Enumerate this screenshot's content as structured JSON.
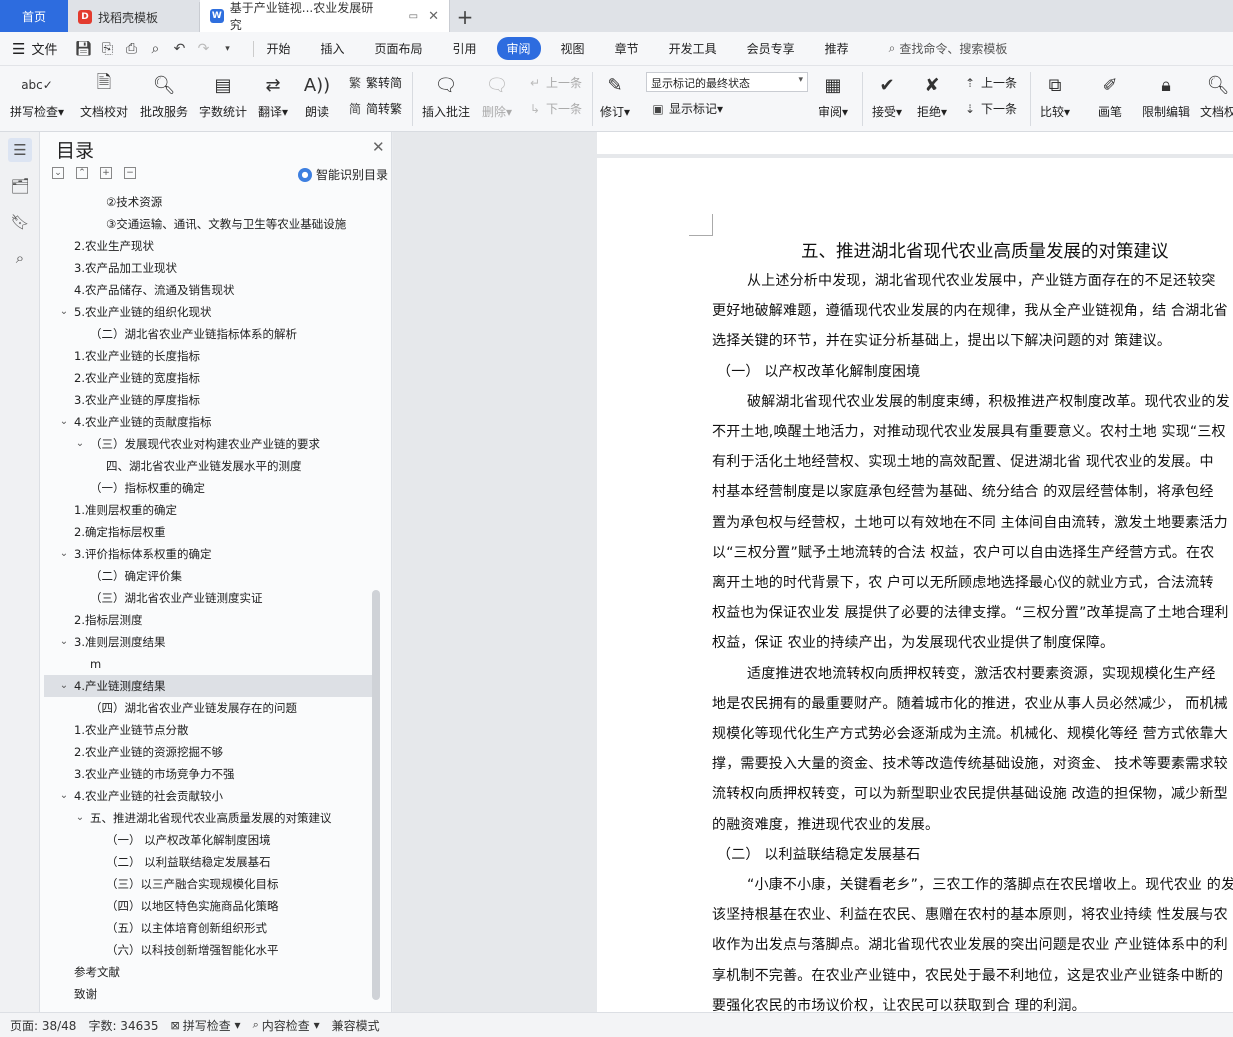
{
  "tabs": {
    "home": "首页",
    "template": "找稻壳模板",
    "doc": "基于产业链视...农业发展研究"
  },
  "menu": {
    "file": "文件",
    "items": [
      "开始",
      "插入",
      "页面布局",
      "引用",
      "审阅",
      "视图",
      "章节",
      "开发工具",
      "会员专享",
      "推荐"
    ],
    "active": "审阅",
    "search": "查找命令、搜索模板"
  },
  "ribbon": {
    "spell": "拼写检查",
    "proof": "文档校对",
    "batch": "批改服务",
    "count": "字数统计",
    "translate": "翻译",
    "read": "朗读",
    "trad": "繁转简",
    "simp": "简转繁",
    "insert_comment": "插入批注",
    "delete": "删除",
    "prev": "上一条",
    "next": "下一条",
    "track": "修订",
    "markup_select": "显示标记的最终状态",
    "show_markup": "显示标记",
    "review": "审阅",
    "accept": "接受",
    "reject": "拒绝",
    "prev2": "上一条",
    "next2": "下一条",
    "compare": "比较",
    "pen": "画笔",
    "restrict": "限制编辑",
    "doc_perm": "文档权"
  },
  "toc": {
    "title": "目录",
    "smart": "智能识别目录",
    "items": [
      {
        "text": "②技术资源",
        "level": 4,
        "chev": ""
      },
      {
        "text": "③交通运输、通讯、文教与卫生等农业基础设施",
        "level": 4,
        "chev": ""
      },
      {
        "text": "2.农业生产现状",
        "level": 2,
        "chev": ""
      },
      {
        "text": "3.农产品加工业现状",
        "level": 2,
        "chev": ""
      },
      {
        "text": "4.农产品储存、流通及销售现状",
        "level": 2,
        "chev": ""
      },
      {
        "text": "5.农业产业链的组织化现状",
        "level": 2,
        "chev": "v"
      },
      {
        "text": "（二）湖北省农业产业链指标体系的解析",
        "level": 3,
        "chev": ""
      },
      {
        "text": "1.农业产业链的长度指标",
        "level": 2,
        "chev": ""
      },
      {
        "text": "2.农业产业链的宽度指标",
        "level": 2,
        "chev": ""
      },
      {
        "text": "3.农业产业链的厚度指标",
        "level": 2,
        "chev": ""
      },
      {
        "text": "4.农业产业链的贡献度指标",
        "level": 2,
        "chev": "v"
      },
      {
        "text": "（三）发展现代农业对构建农业产业链的要求",
        "level": 3,
        "chev": "v"
      },
      {
        "text": "四、湖北省农业产业链发展水平的测度",
        "level": 4,
        "chev": ""
      },
      {
        "text": "（一）指标权重的确定",
        "level": 3,
        "chev": ""
      },
      {
        "text": "1.准则层权重的确定",
        "level": 2,
        "chev": ""
      },
      {
        "text": "2.确定指标层权重",
        "level": 2,
        "chev": ""
      },
      {
        "text": "3.评价指标体系权重的确定",
        "level": 2,
        "chev": "v"
      },
      {
        "text": "（二）确定评价集",
        "level": 3,
        "chev": ""
      },
      {
        "text": "（三）湖北省农业产业链测度实证",
        "level": 3,
        "chev": ""
      },
      {
        "text": "2.指标层测度",
        "level": 2,
        "chev": ""
      },
      {
        "text": "3.准则层测度结果",
        "level": 2,
        "chev": "v"
      },
      {
        "text": "m",
        "level": 3,
        "chev": ""
      },
      {
        "text": "4.产业链测度结果",
        "level": 2,
        "chev": "v"
      },
      {
        "text": "（四）湖北省农业产业链发展存在的问题",
        "level": 3,
        "chev": ""
      },
      {
        "text": "1.农业产业链节点分散",
        "level": 2,
        "chev": ""
      },
      {
        "text": "2.农业产业链的资源挖掘不够",
        "level": 2,
        "chev": ""
      },
      {
        "text": "3.农业产业链的市场竞争力不强",
        "level": 2,
        "chev": ""
      },
      {
        "text": "4.农业产业链的社会贡献较小",
        "level": 2,
        "chev": "v"
      },
      {
        "text": "五、推进湖北省现代农业高质量发展的对策建议",
        "level": 3,
        "chev": "v"
      },
      {
        "text": "（一） 以产权改革化解制度困境",
        "level": 4,
        "chev": ""
      },
      {
        "text": "（二） 以利益联结稳定发展基石",
        "level": 4,
        "chev": ""
      },
      {
        "text": "（三）以三产融合实现规模化目标",
        "level": 4,
        "chev": ""
      },
      {
        "text": "（四）以地区特色实施商品化策略",
        "level": 4,
        "chev": ""
      },
      {
        "text": "（五）以主体培育创新组织形式",
        "level": 4,
        "chev": ""
      },
      {
        "text": "（六）以科技创新增强智能化水平",
        "level": 4,
        "chev": ""
      },
      {
        "text": "参考文献",
        "level": 2,
        "chev": ""
      },
      {
        "text": "致谢",
        "level": 2,
        "chev": ""
      }
    ],
    "highlighted_index": 22
  },
  "doc": {
    "heading": "五、推进湖北省现代农业高质量发展的对策建议",
    "lines": [
      {
        "text": "从上述分析中发现，湖北省现代农业发展中，产业链方面存在的不足还较突",
        "type": "ind"
      },
      {
        "text": "更好地破解难题，遵循现代农业发展的内在规律，我从全产业链视角，结 合湖北省",
        "type": "body"
      },
      {
        "text": "选择关键的环节，并在实证分析基础上，提出以下解决问题的对 策建议。",
        "type": "body"
      },
      {
        "text": "（一） 以产权改革化解制度困境",
        "type": "sub"
      },
      {
        "text": "破解湖北省现代农业发展的制度束缚，积极推进产权制度改革。现代农业的发",
        "type": "ind"
      },
      {
        "text": "不开土地,唤醒土地活力，对推动现代农业发展具有重要意义。农村土地 实现“三权",
        "type": "body"
      },
      {
        "text": "有利于活化土地经营权、实现土地的高效配置、促进湖北省 现代农业的发展。中",
        "type": "body"
      },
      {
        "text": "村基本经营制度是以家庭承包经营为基础、统分结合 的双层经营体制，将承包经",
        "type": "body"
      },
      {
        "text": "置为承包权与经营权，土地可以有效地在不同 主体间自由流转，激发土地要素活力",
        "type": "body"
      },
      {
        "text": "以“三权分置”赋予土地流转的合法 权益，农户可以自由选择生产经营方式。在农",
        "type": "body"
      },
      {
        "text": "离开土地的时代背景下，农 户可以无所顾虑地选择最心仪的就业方式，合法流转",
        "type": "body"
      },
      {
        "text": "权益也为保证农业发 展提供了必要的法律支撑。“三权分置”改革提高了土地合理利",
        "type": "body"
      },
      {
        "text": "权益，保证 农业的持续产出，为发展现代农业提供了制度保障。",
        "type": "body"
      },
      {
        "text": "适度推进农地流转权向质押权转变，激活农村要素资源，实现规模化生产经",
        "type": "ind"
      },
      {
        "text": "地是农民拥有的最重要财产。随着城市化的推进，农业从事人员必然减少， 而机械",
        "type": "body"
      },
      {
        "text": "规模化等现代化生产方式势必会逐渐成为主流。机械化、规模化等经 营方式依靠大",
        "type": "body"
      },
      {
        "text": "撑，需要投入大量的资金、技术等改造传统基础设施，对资金、 技术等要素需求较",
        "type": "body"
      },
      {
        "text": "流转权向质押权转变，可以为新型职业农民提供基础设施 改造的担保物，减少新型",
        "type": "body"
      },
      {
        "text": "的融资难度，推进现代农业的发展。",
        "type": "body"
      },
      {
        "text": "（二） 以利益联结稳定发展基石",
        "type": "sub"
      },
      {
        "text": "“小康不小康，关键看老乡”，三农工作的落脚点在农民增收上。现代农业 的发",
        "type": "ind"
      },
      {
        "text": "该坚持根基在农业、利益在农民、惠赠在农村的基本原则，将农业持续 性发展与农",
        "type": "body"
      },
      {
        "text": "收作为出发点与落脚点。湖北省现代农业发展的突出问题是农业 产业链体系中的利",
        "type": "body"
      },
      {
        "text": "享机制不完善。在农业产业链中，农民处于最不利地位，这是农业产业链条中断的",
        "type": "body"
      },
      {
        "text": "要强化农民的市场议价权，让农民可以获取到合 理的利润。",
        "type": "body"
      }
    ]
  },
  "status": {
    "page": "页面: 38/48",
    "words": "字数: 34635",
    "spell": "拼写检查",
    "content": "内容检查",
    "mode": "兼容模式"
  },
  "colors": {
    "accent": "#2d6cdf",
    "wps_red": "#e33b2e",
    "wps_blue": "#2f6fde"
  }
}
